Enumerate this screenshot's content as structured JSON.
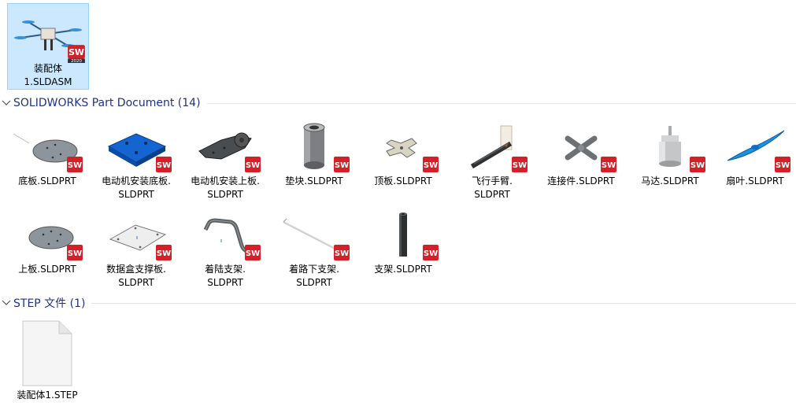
{
  "assembly": {
    "items": [
      {
        "name_line1": "装配体",
        "name_line2": "1.SLDASM",
        "badge_year": "2020"
      }
    ]
  },
  "part_group": {
    "title": "SOLIDWORKS Part Document (14)",
    "items": [
      {
        "line1": "底板.SLDPRT",
        "line2": ""
      },
      {
        "line1": "电动机安装底板.",
        "line2": "SLDPRT"
      },
      {
        "line1": "电动机安装上板.",
        "line2": "SLDPRT"
      },
      {
        "line1": "垫块.SLDPRT",
        "line2": ""
      },
      {
        "line1": "顶板.SLDPRT",
        "line2": ""
      },
      {
        "line1": "飞行手臂.",
        "line2": "SLDPRT"
      },
      {
        "line1": "连接件.SLDPRT",
        "line2": ""
      },
      {
        "line1": "马达.SLDPRT",
        "line2": ""
      },
      {
        "line1": "扇叶.SLDPRT",
        "line2": ""
      },
      {
        "line1": "上板.SLDPRT",
        "line2": ""
      },
      {
        "line1": "数据盒支撑板.",
        "line2": "SLDPRT"
      },
      {
        "line1": "着陆支架.",
        "line2": "SLDPRT"
      },
      {
        "line1": "着路下支架.",
        "line2": "SLDPRT"
      },
      {
        "line1": "支架.SLDPRT",
        "line2": ""
      }
    ]
  },
  "step_group": {
    "title": "STEP 文件 (1)",
    "items": [
      {
        "line1": "装配体1.STEP"
      }
    ]
  },
  "badge": {
    "text": "SW",
    "color": "#d42027"
  },
  "colors": {
    "header_text": "#1e3287",
    "selection": "#cce8ff"
  }
}
